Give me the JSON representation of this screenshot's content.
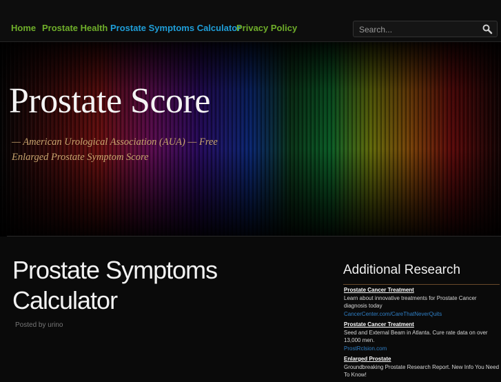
{
  "nav": {
    "items": [
      {
        "label": "Home",
        "color": "#6fae2a"
      },
      {
        "label": "Prostate Health",
        "color": "#6fae2a"
      },
      {
        "label": "Prostate Symptoms Calculator",
        "color": "#1f9ed8"
      },
      {
        "label": "Privacy Policy",
        "color": "#6fae2a"
      }
    ]
  },
  "search": {
    "placeholder": "Search...",
    "icon": "magnifier-icon"
  },
  "header": {
    "site_title": "Prostate Score",
    "tagline": "— American Urological Association (AUA) — Free Enlarged Prostate Symptom Score"
  },
  "post": {
    "title": "Prostate Symptoms Calculator",
    "meta": "Posted by urino"
  },
  "sidebar": {
    "title": "Additional Research",
    "ads": [
      {
        "title": "Prostate Cancer Treatment",
        "desc": "Learn about innovative treatments for Prostate Cancer diagnosis today",
        "url": "CancerCenter.com/CareThatNeverQuits"
      },
      {
        "title": "Prostate Cancer Treatment",
        "desc": "Seed and External Beam in Atlanta. Cure rate data on over 13,000 men.",
        "url": "ProstRclsion.com"
      },
      {
        "title": "Enlarged Prostate",
        "desc": "Groundbreaking Prostate Research Report. New Info You Need To Know!",
        "url": ""
      }
    ]
  },
  "colors": {
    "nav_link": "#6fae2a",
    "nav_active": "#1f9ed8",
    "tagline": "#c8a46e",
    "ad_url": "#2f7fc6"
  }
}
